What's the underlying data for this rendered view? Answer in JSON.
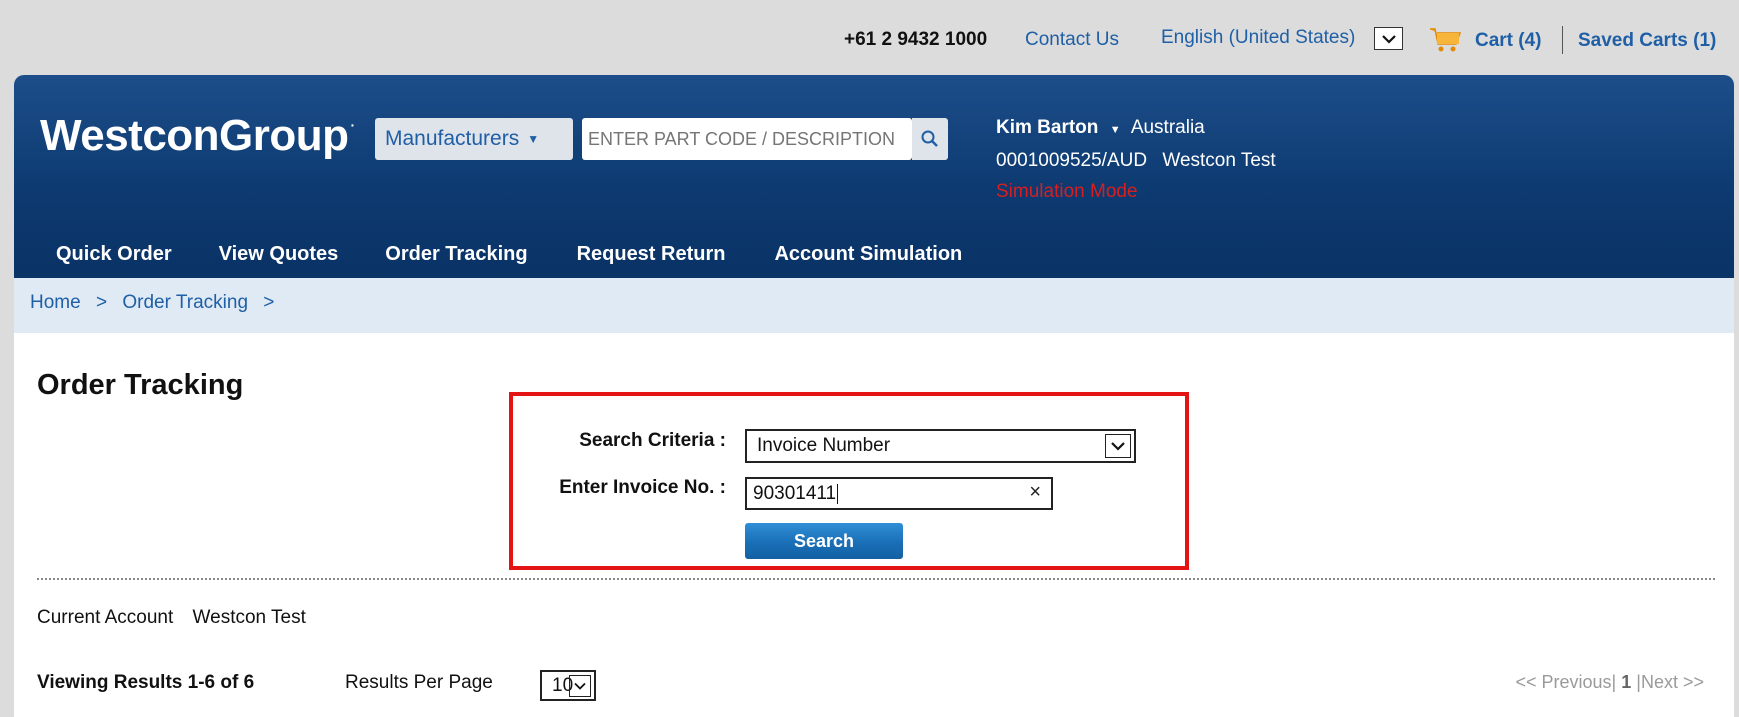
{
  "topbar": {
    "phone": "+61 2 9432 1000",
    "contact": "Contact Us",
    "language": "English (United States)",
    "cart": "Cart (4)",
    "saved_carts": "Saved Carts (1)"
  },
  "header": {
    "logo": "WestconGroup",
    "logo_mark": "·",
    "manufacturers": "Manufacturers",
    "search_placeholder": "ENTER PART CODE / DESCRIPTION",
    "user_name": "Kim Barton",
    "country": "Australia",
    "account": "0001009525/AUD",
    "account_name": "Westcon Test",
    "simulation": "Simulation Mode"
  },
  "nav": {
    "items": [
      {
        "label": "Quick Order"
      },
      {
        "label": "View Quotes"
      },
      {
        "label": "Order Tracking"
      },
      {
        "label": "Request Return"
      },
      {
        "label": "Account Simulation"
      }
    ]
  },
  "breadcrumb": {
    "home": "Home",
    "current": "Order Tracking",
    "sep": ">"
  },
  "main": {
    "title": "Order Tracking",
    "criteria_label": "Search Criteria :",
    "criteria_value": "Invoice Number",
    "invoice_label": "Enter Invoice No. :",
    "invoice_value": "90301411",
    "search_button": "Search",
    "current_account_label": "Current Account",
    "current_account_value": "Westcon Test",
    "viewing": "Viewing Results 1-6 of 6",
    "rpp_label": "Results Per Page",
    "rpp_value": "10",
    "pager_prev": "<< Previous|",
    "pager_page": "1",
    "pager_next": "|Next >>"
  },
  "colors": {
    "header_blue": "#0d3a71",
    "link_blue": "#1f5fa6",
    "simulation_red": "#d81e1e",
    "highlight_red": "#e41414"
  }
}
